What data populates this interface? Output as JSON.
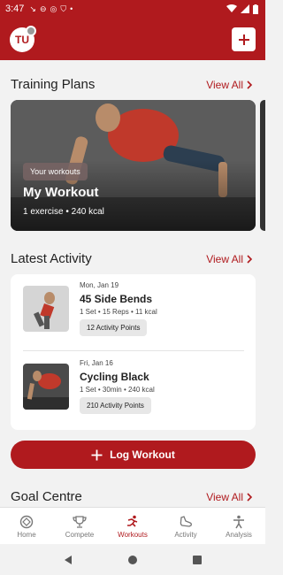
{
  "status": {
    "time": "3:47"
  },
  "header": {
    "avatar_initials": "TU"
  },
  "training": {
    "title": "Training Plans",
    "view_all": "View All",
    "card": {
      "tag": "Your workouts",
      "title": "My Workout",
      "subtitle": "1 exercise • 240 kcal"
    }
  },
  "activity": {
    "title": "Latest Activity",
    "view_all": "View All",
    "items": [
      {
        "date": "Mon, Jan 19",
        "name": "45 Side Bends",
        "meta": "1 Set • 15 Reps • 11 kcal",
        "points": "12 Activity Points"
      },
      {
        "date": "Fri, Jan 16",
        "name": "Cycling Black",
        "meta": "1 Set • 30min • 240 kcal",
        "points": "210 Activity Points"
      }
    ]
  },
  "log_workout": {
    "label": "Log Workout"
  },
  "goal": {
    "title": "Goal Centre",
    "view_all": "View All"
  },
  "tabs": [
    {
      "label": "Home",
      "icon": "target-icon"
    },
    {
      "label": "Compete",
      "icon": "trophy-icon"
    },
    {
      "label": "Workouts",
      "icon": "runner-icon"
    },
    {
      "label": "Activity",
      "icon": "shoe-icon"
    },
    {
      "label": "Analysis",
      "icon": "person-icon"
    }
  ],
  "colors": {
    "brand": "#b01a1e"
  }
}
